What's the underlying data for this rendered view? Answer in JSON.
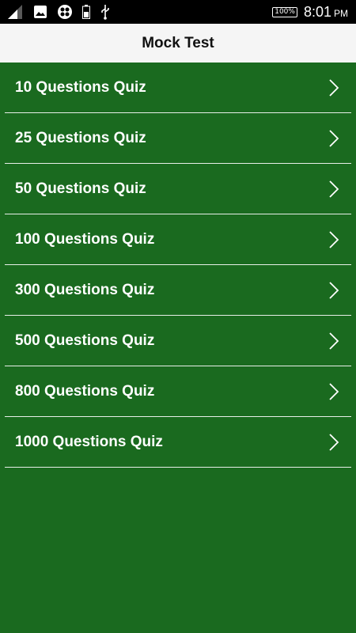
{
  "status_bar": {
    "battery_percent": "100%",
    "time": "8:01",
    "ampm": "PM",
    "icons": [
      "signal-icon",
      "image-icon",
      "app-icon",
      "battery-small-icon",
      "usb-icon"
    ]
  },
  "app_bar": {
    "title": "Mock Test"
  },
  "quiz_list": {
    "items": [
      {
        "label": "10 Questions Quiz"
      },
      {
        "label": "25 Questions Quiz"
      },
      {
        "label": "50 Questions Quiz"
      },
      {
        "label": "100 Questions Quiz"
      },
      {
        "label": "300 Questions Quiz"
      },
      {
        "label": "500 Questions Quiz"
      },
      {
        "label": "800 Questions Quiz"
      },
      {
        "label": "1000 Questions Quiz"
      }
    ]
  },
  "colors": {
    "background": "#1a6a1f",
    "app_bar": "#f5f5f5",
    "status_bar": "#000000",
    "text": "#ffffff"
  }
}
